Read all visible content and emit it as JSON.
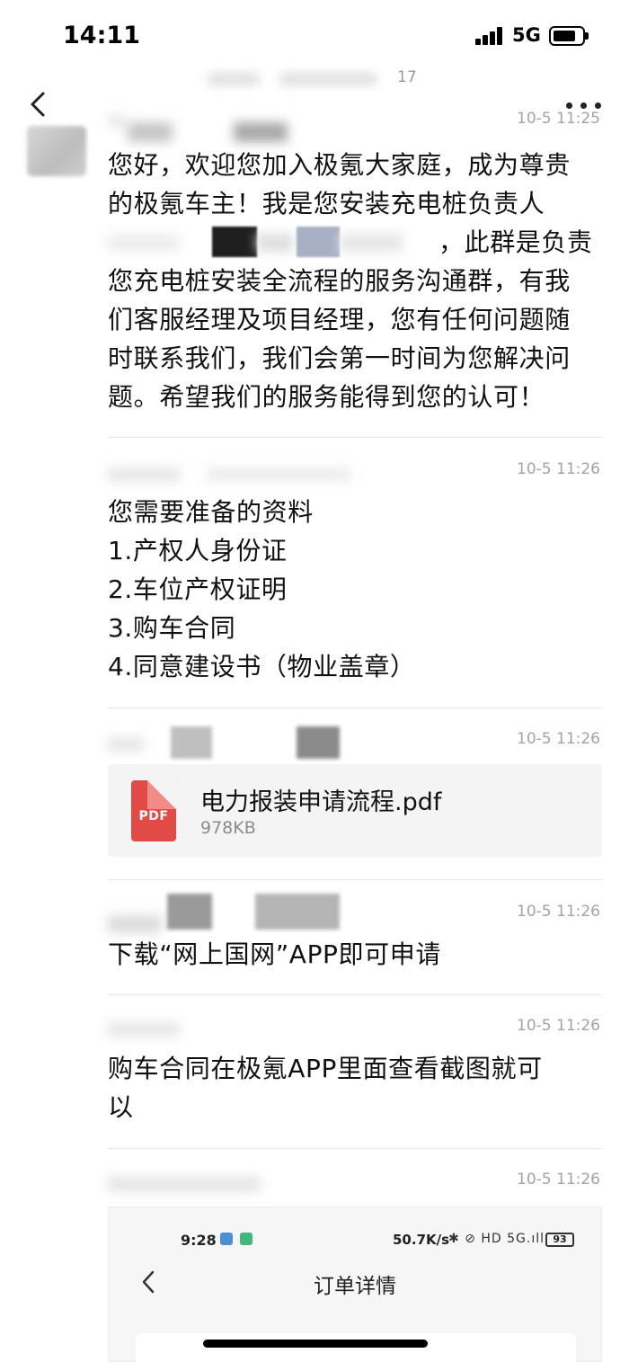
{
  "status_bar": {
    "time": "14:11",
    "network": "5G"
  },
  "header": {
    "subtitle_tail": "17"
  },
  "messages": [
    {
      "time": "10-5 11:25",
      "lines": [
        "您好，欢迎您加入极氪大家庭，成为尊贵",
        "的极氪车主！我是您安装充电桩负责人",
        "，此群是负责",
        "您充电桩安装全流程的服务沟通群，有我",
        "们客服经理及项目经理，您有任何问题随",
        "时联系我们，我们会第一时间为您解决问",
        "题。希望我们的服务能得到您的认可！"
      ]
    },
    {
      "time": "10-5 11:26",
      "lines": [
        "您需要准备的资料",
        "1.产权人身份证",
        "2.车位产权证明",
        "3.购车合同",
        "4.同意建设书（物业盖章）"
      ]
    },
    {
      "time": "10-5 11:26",
      "file": {
        "name": "电力报装申请流程.pdf",
        "size": "978KB",
        "type_label": "PDF"
      }
    },
    {
      "time": "10-5 11:26",
      "lines": [
        "下载“网上国网”APP即可申请"
      ]
    },
    {
      "time": "10-5 11:26",
      "lines": [
        "购车合同在极氪APP里面查看截图就可",
        "以"
      ]
    },
    {
      "time": "10-5 11:26",
      "screenshot": {
        "time": "9:28",
        "speed": "50.7K/s",
        "icons": "✱ ⊘ HD 5G.ıll",
        "battery": "93",
        "title": "订单详情"
      }
    }
  ],
  "colors": {
    "pdf_red": "#e24a45",
    "timestamp_gray": "#a3a3a3",
    "divider": "#e6e6e6"
  }
}
